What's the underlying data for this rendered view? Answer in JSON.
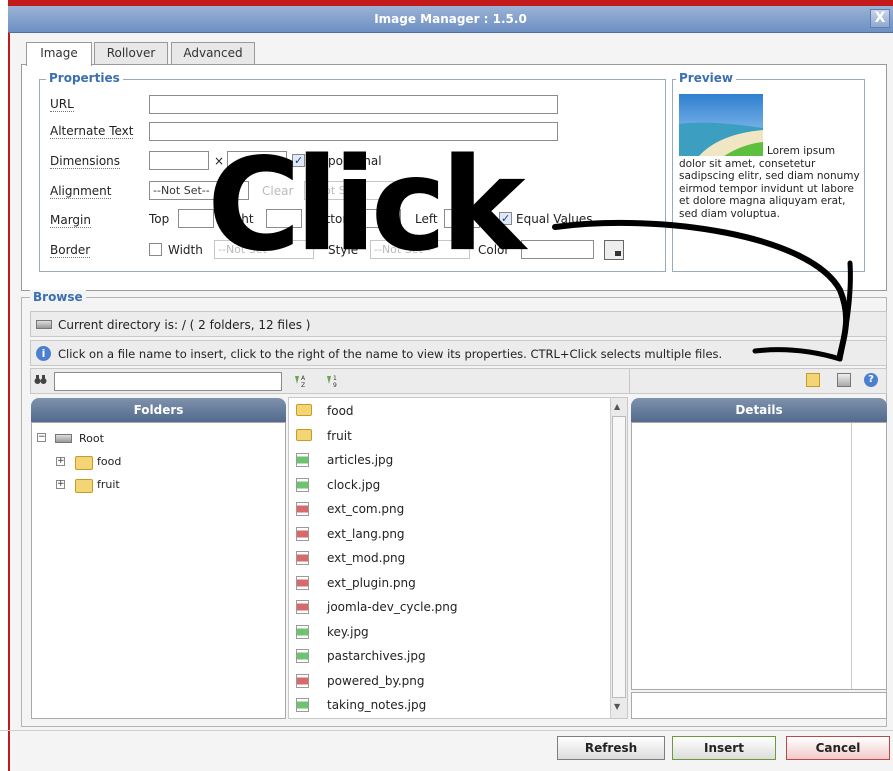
{
  "window": {
    "title": "Image Manager : 1.5.0",
    "close_glyph": "X"
  },
  "tabs": [
    {
      "label": "Image"
    },
    {
      "label": "Rollover"
    },
    {
      "label": "Advanced"
    }
  ],
  "properties": {
    "legend": "Properties",
    "url_label": "URL",
    "alt_label": "Alternate Text",
    "dimensions_label": "Dimensions",
    "dimensions_times": "×",
    "proportional_label": "Proportional",
    "alignment_label": "Alignment",
    "alignment_value": "--Not Set--",
    "clear_label": "Clear",
    "clear_value": "--Not Set--",
    "margin_label": "Margin",
    "margin_top": "Top",
    "margin_right": "Right",
    "margin_bottom": "Bottom",
    "margin_left": "Left",
    "equal_values": "Equal Values",
    "border_label": "Border",
    "border_width": "Width",
    "border_width_value": "--Not Set--",
    "border_style": "Style",
    "border_style_value": "--Not Set--",
    "border_color": "Color"
  },
  "preview": {
    "legend": "Preview",
    "text": "Lorem ipsum dolor sit amet, consetetur sadipscing elitr, sed diam nonumy eirmod tempor invidunt ut labore et dolore magna aliquyam erat, sed diam voluptua."
  },
  "browse": {
    "legend": "Browse",
    "current_dir": "Current directory is: / ( 2 folders, 12 files )",
    "info": "Click on a file name to insert, click to the right of the name to view its properties. CTRL+Click selects multiple files.",
    "folders_header": "Folders",
    "details_header": "Details",
    "tree": {
      "root": "Root",
      "children": [
        {
          "label": "food"
        },
        {
          "label": "fruit"
        }
      ]
    },
    "files": [
      {
        "name": "food",
        "kind": "folder"
      },
      {
        "name": "fruit",
        "kind": "folder"
      },
      {
        "name": "articles.jpg",
        "kind": "jpg"
      },
      {
        "name": "clock.jpg",
        "kind": "jpg"
      },
      {
        "name": "ext_com.png",
        "kind": "png"
      },
      {
        "name": "ext_lang.png",
        "kind": "png"
      },
      {
        "name": "ext_mod.png",
        "kind": "png"
      },
      {
        "name": "ext_plugin.png",
        "kind": "png"
      },
      {
        "name": "joomla-dev_cycle.png",
        "kind": "png"
      },
      {
        "name": "key.jpg",
        "kind": "jpg"
      },
      {
        "name": "pastarchives.jpg",
        "kind": "jpg"
      },
      {
        "name": "powered_by.png",
        "kind": "png"
      },
      {
        "name": "taking_notes.jpg",
        "kind": "jpg"
      }
    ]
  },
  "buttons": {
    "refresh": "Refresh",
    "insert": "Insert",
    "cancel": "Cancel"
  },
  "overlay": {
    "text": "Click"
  },
  "colors": {
    "accent": "#3a6fb0",
    "title_bar": "#7f9bc9",
    "frame_red": "#c21a1a",
    "panel_header": "#5f7696"
  }
}
